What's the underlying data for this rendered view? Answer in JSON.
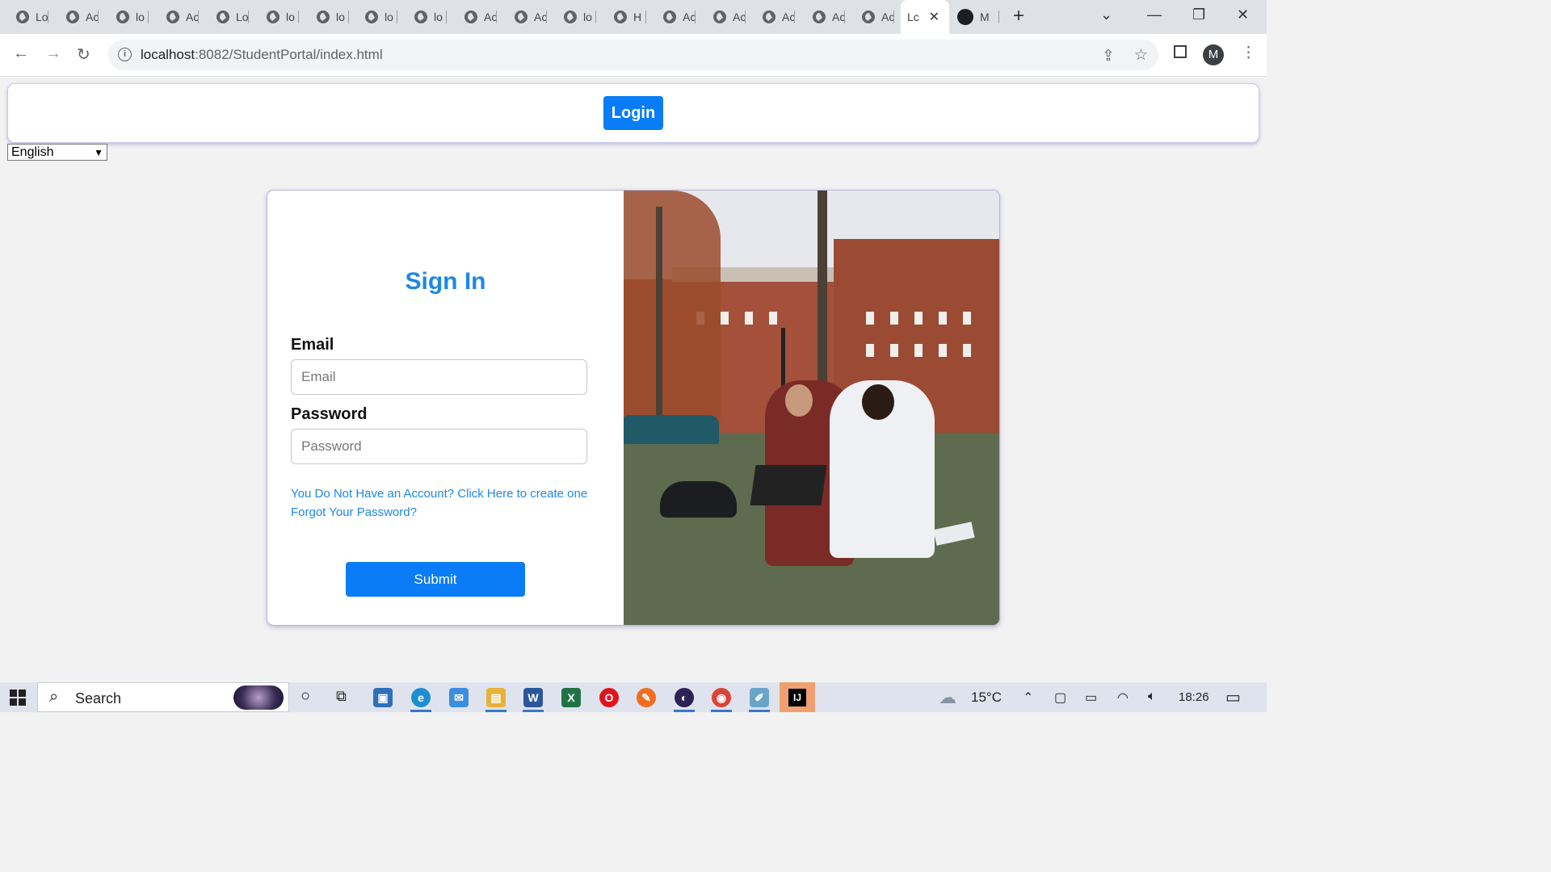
{
  "browser": {
    "tabs": [
      {
        "title": "Lo"
      },
      {
        "title": "Ac"
      },
      {
        "title": "lo"
      },
      {
        "title": "Ac"
      },
      {
        "title": "Lo"
      },
      {
        "title": "lo"
      },
      {
        "title": "lo"
      },
      {
        "title": "lo"
      },
      {
        "title": "lo"
      },
      {
        "title": "Ac"
      },
      {
        "title": "Ac"
      },
      {
        "title": "lo"
      },
      {
        "title": "H"
      },
      {
        "title": "Ac"
      },
      {
        "title": "Ac"
      },
      {
        "title": "Ac"
      },
      {
        "title": "Ac"
      },
      {
        "title": "Ac"
      }
    ],
    "active_tab": {
      "title": "Lc",
      "close": "✕"
    },
    "github_tab": {
      "title": "M"
    },
    "new_tab": "+",
    "url_host": "localhost",
    "url_path": ":8082/StudentPortal/index.html",
    "profile_initial": "M"
  },
  "page": {
    "login_button": "Login",
    "language_selected": "English",
    "signin_title": "Sign In",
    "email_label": "Email",
    "email_placeholder": "Email",
    "password_label": "Password",
    "password_placeholder": "Password",
    "register_link": "You Do Not Have an Account? Click Here to create one",
    "forgot_link": "Forgot Your Password?",
    "submit_button": "Submit"
  },
  "taskbar": {
    "search_text": "Search",
    "weather": "15°C",
    "time": "18:26"
  },
  "icons": {
    "back": "arrow-left-icon",
    "forward": "arrow-right-icon",
    "reload": "reload-icon",
    "share": "share-icon",
    "bookmark": "star-icon",
    "sidepanel": "side-panel-icon",
    "menu": "kebab-menu-icon"
  }
}
